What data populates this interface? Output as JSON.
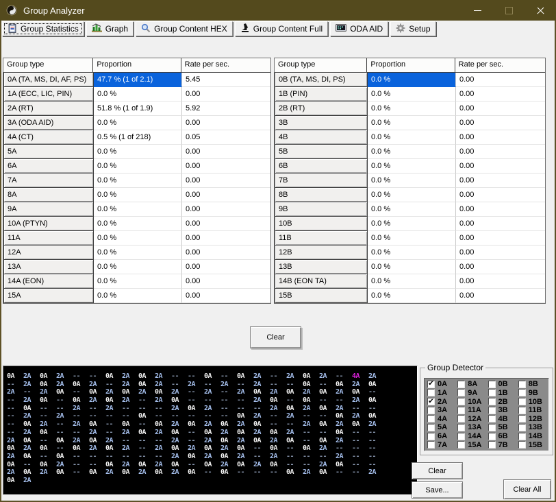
{
  "window": {
    "title": "Group Analyzer"
  },
  "tabs": [
    {
      "label": "Group Statistics",
      "icon": "statistics-icon",
      "active": true
    },
    {
      "label": "Graph",
      "icon": "graph-icon",
      "active": false
    },
    {
      "label": "Group Content HEX",
      "icon": "magnifier-icon",
      "active": false
    },
    {
      "label": "Group Content Full",
      "icon": "microscope-icon",
      "active": false
    },
    {
      "label": "ODA AID",
      "icon": "display-icon",
      "active": false
    },
    {
      "label": "Setup",
      "icon": "gear-icon",
      "active": false
    }
  ],
  "table_headers": [
    "Group type",
    "Proportion",
    "Rate per sec."
  ],
  "left_table": [
    {
      "type": "0A (TA, MS, DI, AF, PS)",
      "proportion": "47.7 % (1 of 2.1)",
      "rate": "5.45",
      "selected": true
    },
    {
      "type": "1A (ECC, LIC, PIN)",
      "proportion": "0.0 %",
      "rate": "0.00",
      "selected": false
    },
    {
      "type": "2A (RT)",
      "proportion": "51.8 % (1 of 1.9)",
      "rate": "5.92",
      "selected": false
    },
    {
      "type": "3A (ODA AID)",
      "proportion": "0.0 %",
      "rate": "0.00",
      "selected": false
    },
    {
      "type": "4A (CT)",
      "proportion": "0.5 % (1 of 218)",
      "rate": "0.05",
      "selected": false
    },
    {
      "type": "5A",
      "proportion": "0.0 %",
      "rate": "0.00",
      "selected": false
    },
    {
      "type": "6A",
      "proportion": "0.0 %",
      "rate": "0.00",
      "selected": false
    },
    {
      "type": "7A",
      "proportion": "0.0 %",
      "rate": "0.00",
      "selected": false
    },
    {
      "type": "8A",
      "proportion": "0.0 %",
      "rate": "0.00",
      "selected": false
    },
    {
      "type": "9A",
      "proportion": "0.0 %",
      "rate": "0.00",
      "selected": false
    },
    {
      "type": "10A (PTYN)",
      "proportion": "0.0 %",
      "rate": "0.00",
      "selected": false
    },
    {
      "type": "11A",
      "proportion": "0.0 %",
      "rate": "0.00",
      "selected": false
    },
    {
      "type": "12A",
      "proportion": "0.0 %",
      "rate": "0.00",
      "selected": false
    },
    {
      "type": "13A",
      "proportion": "0.0 %",
      "rate": "0.00",
      "selected": false
    },
    {
      "type": "14A (EON)",
      "proportion": "0.0 %",
      "rate": "0.00",
      "selected": false
    },
    {
      "type": "15A",
      "proportion": "0.0 %",
      "rate": "0.00",
      "selected": false
    }
  ],
  "right_table": [
    {
      "type": "0B (TA, MS, DI, PS)",
      "proportion": "0.0 %",
      "rate": "0.00",
      "selected": true
    },
    {
      "type": "1B (PIN)",
      "proportion": "0.0 %",
      "rate": "0.00",
      "selected": false
    },
    {
      "type": "2B (RT)",
      "proportion": "0.0 %",
      "rate": "0.00",
      "selected": false
    },
    {
      "type": "3B",
      "proportion": "0.0 %",
      "rate": "0.00",
      "selected": false
    },
    {
      "type": "4B",
      "proportion": "0.0 %",
      "rate": "0.00",
      "selected": false
    },
    {
      "type": "5B",
      "proportion": "0.0 %",
      "rate": "0.00",
      "selected": false
    },
    {
      "type": "6B",
      "proportion": "0.0 %",
      "rate": "0.00",
      "selected": false
    },
    {
      "type": "7B",
      "proportion": "0.0 %",
      "rate": "0.00",
      "selected": false
    },
    {
      "type": "8B",
      "proportion": "0.0 %",
      "rate": "0.00",
      "selected": false
    },
    {
      "type": "9B",
      "proportion": "0.0 %",
      "rate": "0.00",
      "selected": false
    },
    {
      "type": "10B",
      "proportion": "0.0 %",
      "rate": "0.00",
      "selected": false
    },
    {
      "type": "11B",
      "proportion": "0.0 %",
      "rate": "0.00",
      "selected": false
    },
    {
      "type": "12B",
      "proportion": "0.0 %",
      "rate": "0.00",
      "selected": false
    },
    {
      "type": "13B",
      "proportion": "0.0 %",
      "rate": "0.00",
      "selected": false
    },
    {
      "type": "14B (EON TA)",
      "proportion": "0.0 %",
      "rate": "0.00",
      "selected": false
    },
    {
      "type": "15B",
      "proportion": "0.0 %",
      "rate": "0.00",
      "selected": false
    }
  ],
  "center": {
    "clear_label": "Clear"
  },
  "monitor": {
    "token_colors": {
      "0A": "#f2f2f2",
      "2A": "#a6c0ee",
      "4A": "#e322e3",
      "--": "#8b9ab2"
    },
    "rows": [
      [
        "0A",
        "2A",
        "0A",
        "2A",
        "--",
        "--",
        "0A",
        "2A",
        "0A",
        "2A",
        "--",
        "--",
        "0A",
        "--",
        "0A",
        "2A",
        "--",
        "2A",
        "0A",
        "2A",
        "--",
        "4A",
        "2A"
      ],
      [
        "--",
        "2A",
        "0A",
        "2A",
        "0A",
        "2A",
        "--",
        "2A",
        "0A",
        "2A",
        "--",
        "2A",
        "--",
        "2A",
        "--",
        "2A",
        "--",
        "--",
        "0A",
        "--",
        "0A",
        "2A",
        "0A"
      ],
      [
        "2A",
        "--",
        "2A",
        "0A",
        "--",
        "0A",
        "2A",
        "0A",
        "2A",
        "0A",
        "2A",
        "--",
        "2A",
        "--",
        "2A",
        "0A",
        "2A",
        "0A",
        "2A",
        "0A",
        "2A",
        "0A",
        "--"
      ],
      [
        "--",
        "2A",
        "0A",
        "--",
        "0A",
        "2A",
        "0A",
        "2A",
        "--",
        "2A",
        "0A",
        "--",
        "--",
        "--",
        "--",
        "2A",
        "0A",
        "--",
        "0A",
        "--",
        "--",
        "2A",
        "0A"
      ],
      [
        "--",
        "0A",
        "--",
        "--",
        "2A",
        "--",
        "2A",
        "--",
        "--",
        "--",
        "2A",
        "0A",
        "2A",
        "--",
        "--",
        "--",
        "2A",
        "0A",
        "2A",
        "0A",
        "2A",
        "--",
        "--"
      ],
      [
        "--",
        "2A",
        "--",
        "2A",
        "--",
        "--",
        "--",
        "--",
        "0A",
        "--",
        "--",
        "--",
        "--",
        "--",
        "0A",
        "2A",
        "--",
        "2A",
        "--",
        "--",
        "0A",
        "2A",
        "0A"
      ],
      [
        "--",
        "0A",
        "2A",
        "--",
        "2A",
        "0A",
        "--",
        "0A",
        "--",
        "0A",
        "2A",
        "0A",
        "2A",
        "0A",
        "2A",
        "0A",
        "--",
        "--",
        "2A",
        "0A",
        "2A",
        "0A",
        "2A"
      ],
      [
        "--",
        "2A",
        "0A",
        "--",
        "--",
        "2A",
        "--",
        "2A",
        "0A",
        "2A",
        "0A",
        "--",
        "0A",
        "2A",
        "0A",
        "2A",
        "0A",
        "2A",
        "--",
        "--",
        "0A",
        "--",
        "--"
      ],
      [
        "2A",
        "0A",
        "--",
        "0A",
        "2A",
        "0A",
        "2A",
        "--",
        "--",
        "--",
        "2A",
        "--",
        "2A",
        "0A",
        "2A",
        "0A",
        "2A",
        "0A",
        "--",
        "0A",
        "2A",
        "--",
        "--"
      ],
      [
        "0A",
        "2A",
        "0A",
        "--",
        "0A",
        "2A",
        "0A",
        "2A",
        "--",
        "2A",
        "0A",
        "2A",
        "0A",
        "2A",
        "0A",
        "--",
        "0A",
        "--",
        "0A",
        "2A",
        "--",
        "--",
        "--"
      ],
      [
        "2A",
        "0A",
        "--",
        "0A",
        "--",
        "--",
        "--",
        "--",
        "--",
        "--",
        "2A",
        "0A",
        "2A",
        "0A",
        "2A",
        "--",
        "2A",
        "--",
        "--",
        "--",
        "2A",
        "--",
        "--"
      ],
      [
        "0A",
        "--",
        "0A",
        "2A",
        "--",
        "--",
        "0A",
        "2A",
        "0A",
        "2A",
        "0A",
        "--",
        "0A",
        "2A",
        "0A",
        "2A",
        "0A",
        "--",
        "--",
        "2A",
        "0A",
        "--",
        "--"
      ],
      [
        "2A",
        "0A",
        "2A",
        "0A",
        "--",
        "0A",
        "2A",
        "0A",
        "2A",
        "0A",
        "2A",
        "0A",
        "--",
        "0A",
        "--",
        "--",
        "--",
        "0A",
        "2A",
        "0A",
        "--",
        "--",
        "2A"
      ],
      [
        "0A",
        "2A",
        "",
        "",
        "",
        "",
        "",
        "",
        "",
        "",
        "",
        "",
        "",
        "",
        "",
        "",
        "",
        "",
        "",
        "",
        "",
        "",
        ""
      ]
    ]
  },
  "detector": {
    "title": "Group Detector",
    "items": [
      {
        "label": "0A",
        "checked": true
      },
      {
        "label": "8A",
        "checked": false
      },
      {
        "label": "0B",
        "checked": false
      },
      {
        "label": "8B",
        "checked": false
      },
      {
        "label": "1A",
        "checked": false
      },
      {
        "label": "9A",
        "checked": false
      },
      {
        "label": "1B",
        "checked": false
      },
      {
        "label": "9B",
        "checked": false
      },
      {
        "label": "2A",
        "checked": true
      },
      {
        "label": "10A",
        "checked": false
      },
      {
        "label": "2B",
        "checked": false
      },
      {
        "label": "10B",
        "checked": false
      },
      {
        "label": "3A",
        "checked": false
      },
      {
        "label": "11A",
        "checked": false
      },
      {
        "label": "3B",
        "checked": false
      },
      {
        "label": "11B",
        "checked": false
      },
      {
        "label": "4A",
        "checked": false
      },
      {
        "label": "12A",
        "checked": false
      },
      {
        "label": "4B",
        "checked": false
      },
      {
        "label": "12B",
        "checked": false
      },
      {
        "label": "5A",
        "checked": false
      },
      {
        "label": "13A",
        "checked": false
      },
      {
        "label": "5B",
        "checked": false
      },
      {
        "label": "13B",
        "checked": false
      },
      {
        "label": "6A",
        "checked": false
      },
      {
        "label": "14A",
        "checked": false
      },
      {
        "label": "6B",
        "checked": false
      },
      {
        "label": "14B",
        "checked": false
      },
      {
        "label": "7A",
        "checked": false
      },
      {
        "label": "15A",
        "checked": false
      },
      {
        "label": "7B",
        "checked": false
      },
      {
        "label": "15B",
        "checked": false
      }
    ]
  },
  "actions": {
    "clear": "Clear",
    "save": "Save...",
    "clear_all": "Clear All"
  }
}
